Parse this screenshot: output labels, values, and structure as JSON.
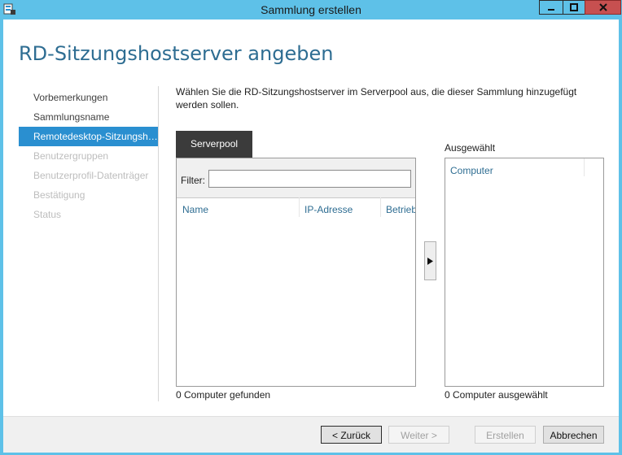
{
  "window": {
    "title": "Sammlung erstellen"
  },
  "page": {
    "heading": "RD-Sitzungshostserver angeben",
    "description": "Wählen Sie die RD-Sitzungshostserver im Serverpool aus, die dieser Sammlung hinzugefügt werden sollen."
  },
  "nav": {
    "items": [
      {
        "label": "Vorbemerkungen",
        "state": "normal"
      },
      {
        "label": "Sammlungsname",
        "state": "normal"
      },
      {
        "label": "Remotedesktop-Sitzungshostserver",
        "state": "active"
      },
      {
        "label": "Benutzergruppen",
        "state": "disabled"
      },
      {
        "label": "Benutzerprofil-Datenträger",
        "state": "disabled"
      },
      {
        "label": "Bestätigung",
        "state": "disabled"
      },
      {
        "label": "Status",
        "state": "disabled"
      }
    ]
  },
  "pool": {
    "tab_label": "Serverpool",
    "filter_label": "Filter:",
    "filter_value": "",
    "columns": [
      "Name",
      "IP-Adresse",
      "Betrieb"
    ],
    "found_text": "0 Computer gefunden"
  },
  "selected": {
    "label": "Ausgewählt",
    "column": "Computer",
    "count_text": "0 Computer ausgewählt"
  },
  "buttons": {
    "back": "< Zurück",
    "next": "Weiter >",
    "create": "Erstellen",
    "cancel": "Abbrechen"
  },
  "icons": {
    "app": "server-manager-icon",
    "move": "arrow-right-icon",
    "minimize": "minimize-icon",
    "maximize": "maximize-icon",
    "close": "close-icon"
  },
  "colors": {
    "title_bar": "#5ec1e8",
    "heading": "#2e6d92",
    "active_nav": "#2a8fd0",
    "close_button": "#c75050",
    "tab": "#3b3b3b"
  }
}
